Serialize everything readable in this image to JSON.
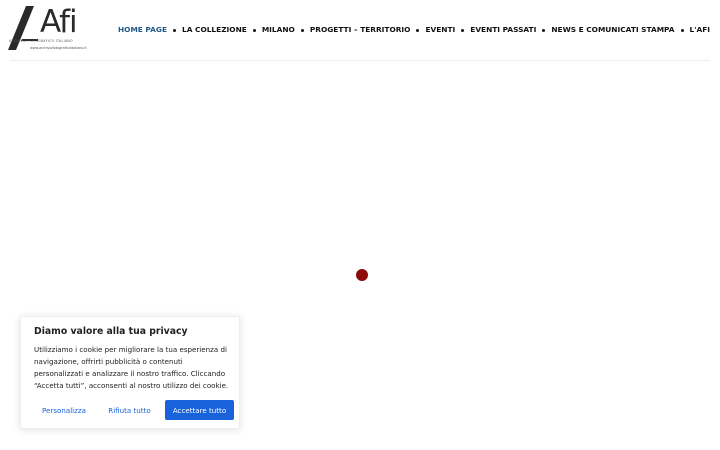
{
  "header": {
    "logo": {
      "text": "Afi",
      "tagline": "Archivio Fotografico Italiano",
      "url": "www.archiviofotograficoitaliano.it"
    },
    "nav": [
      {
        "label": "Home Page",
        "active": true
      },
      {
        "label": "La Collezione"
      },
      {
        "label": "Milano"
      },
      {
        "label": "Progetti – Territorio"
      },
      {
        "label": "Eventi"
      },
      {
        "label": "Eventi Passati"
      },
      {
        "label": "News e Comunicati Stampa"
      },
      {
        "label": "L'AFI"
      }
    ]
  },
  "loader": {
    "color": "#8e0a0a"
  },
  "cookie_banner": {
    "title": "Diamo valore alla tua privacy",
    "text": "Utilizziamo i cookie per migliorare la tua esperienza di navigazione, offrirti pubblicità o contenuti personalizzati e analizzare il nostro traffico. Cliccando “Accetta tutti”, acconsenti al nostro utilizzo dei cookie.",
    "buttons": {
      "customize": "Personalizza",
      "reject": "Rifiuta tutto",
      "accept": "Accettare tutto"
    },
    "accent_color": "#1863dc"
  }
}
